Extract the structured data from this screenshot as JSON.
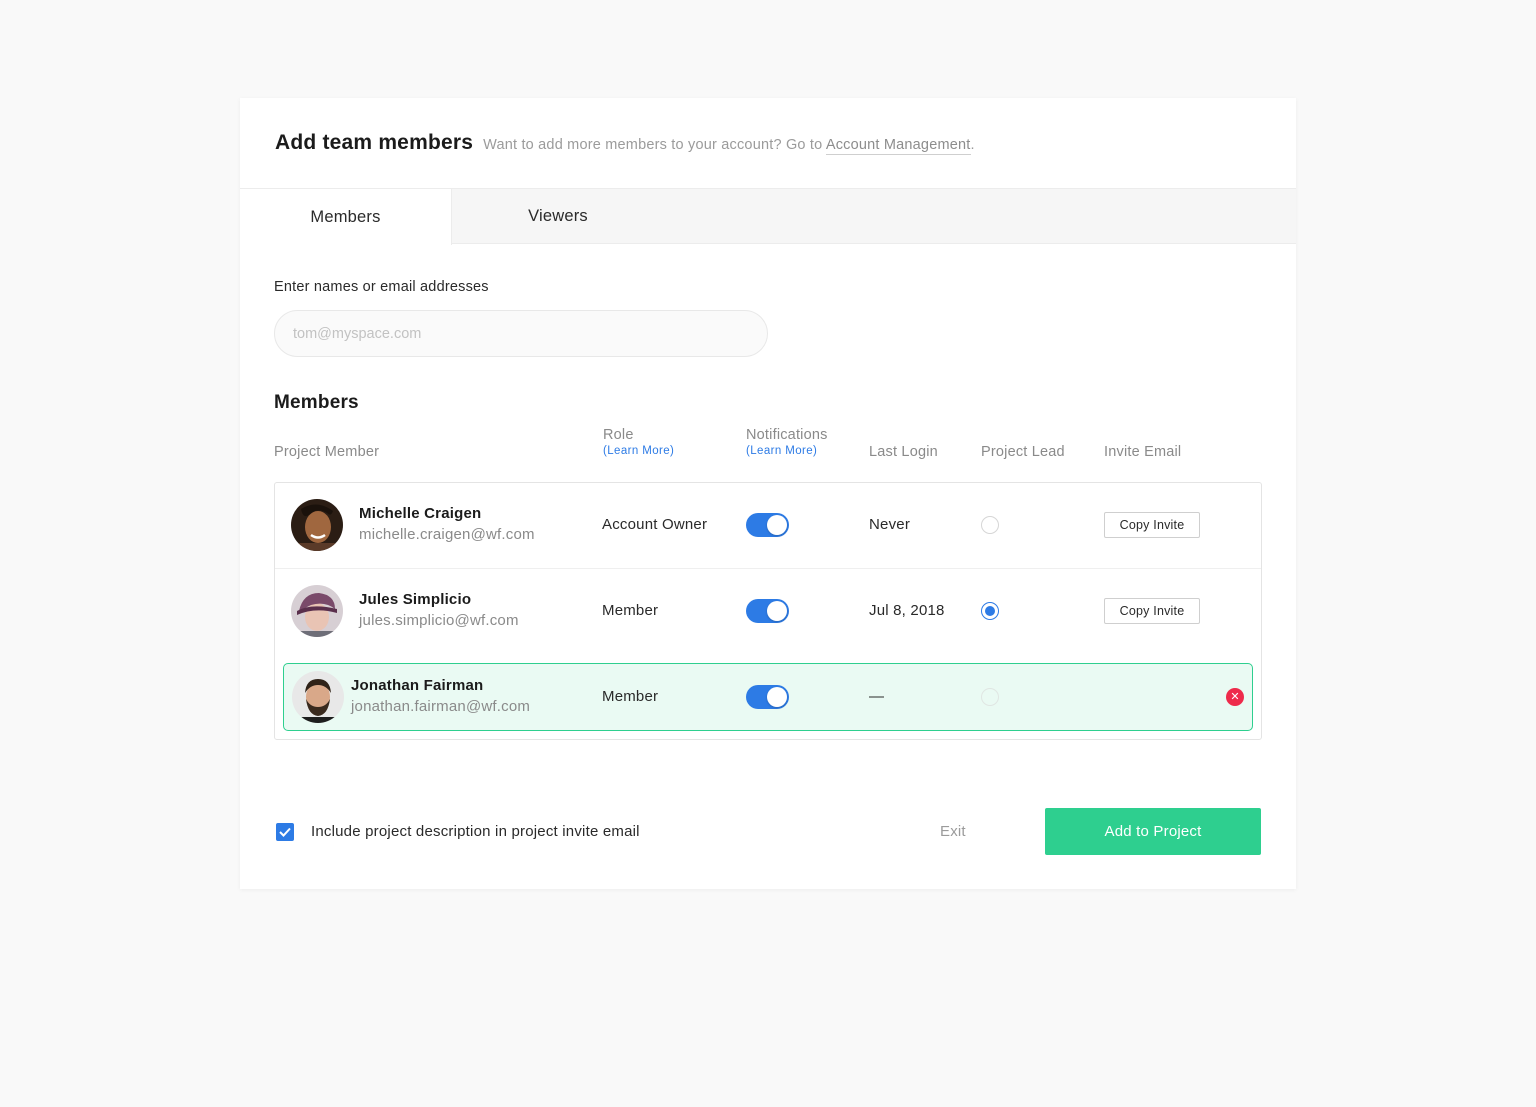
{
  "header": {
    "title": "Add team members",
    "subtitle_prefix": "Want to add more members to your account? Go to ",
    "subtitle_link": "Account Management",
    "subtitle_suffix": "."
  },
  "tabs": [
    {
      "label": "Members",
      "active": true
    },
    {
      "label": "Viewers",
      "active": false
    }
  ],
  "invite": {
    "label": "Enter names or email addresses",
    "placeholder": "tom@myspace.com",
    "value": ""
  },
  "members_section": {
    "title": "Members",
    "columns": {
      "member": "Project Member",
      "role": "Role",
      "role_link": "(Learn More)",
      "notifications": "Notifications",
      "notifications_link": "(Learn More)",
      "last_login": "Last Login",
      "project_lead": "Project Lead",
      "invite_email": "Invite Email"
    },
    "rows": [
      {
        "name": "Michelle Craigen",
        "email": "michelle.craigen@wf.com",
        "role": "Account Owner",
        "notifications": true,
        "last_login": "Never",
        "project_lead": false,
        "invite_action": "Copy Invite"
      },
      {
        "name": "Jules Simplicio",
        "email": "jules.simplicio@wf.com",
        "role": "Member",
        "notifications": true,
        "last_login": "Jul 8, 2018",
        "project_lead": true,
        "invite_action": "Copy Invite"
      },
      {
        "name": "Jonathan Fairman",
        "email": "jonathan.fairman@wf.com",
        "role": "Member",
        "notifications": true,
        "last_login": "—",
        "project_lead": false,
        "remove_icon": "close-icon",
        "highlighted": true
      }
    ]
  },
  "footer": {
    "include_description_checked": true,
    "include_description_label": "Include project description in project invite email",
    "exit_label": "Exit",
    "submit_label": "Add to Project"
  },
  "colors": {
    "accent_blue": "#2d7be5",
    "accent_green": "#2ecf8f",
    "danger_red": "#ee2b4b",
    "highlight_bg": "#eafaf3"
  }
}
